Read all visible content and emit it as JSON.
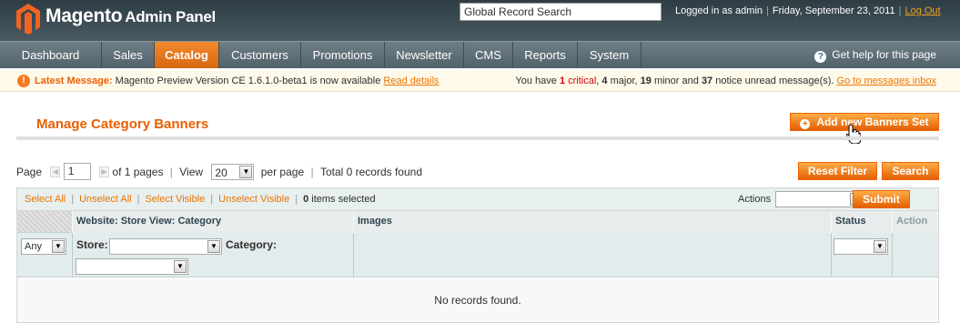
{
  "header": {
    "logo_text": "Magento",
    "logo_sub": "Admin Panel",
    "search_value": "Global Record Search",
    "logged_in": "Logged in as admin",
    "date": "Friday, September 23, 2011",
    "logout": "Log Out"
  },
  "nav": {
    "items": [
      "Dashboard",
      "Sales",
      "Catalog",
      "Customers",
      "Promotions",
      "Newsletter",
      "CMS",
      "Reports",
      "System"
    ],
    "active": "Catalog",
    "help": "Get help for this page"
  },
  "message": {
    "label": "Latest Message:",
    "text": "Magento Preview Version CE 1.6.1.0-beta1 is now available",
    "link": "Read details",
    "right_prefix": "You have",
    "critical_count": "1",
    "critical_label": "critical",
    "major": "4",
    "major_label": "major,",
    "minor": "19",
    "minor_label": "minor and",
    "notice": "37",
    "notice_label": "notice unread message(s).",
    "inbox_link": "Go to messages inbox"
  },
  "page": {
    "title": "Manage Category Banners",
    "add_button": "Add new Banners Set"
  },
  "pager": {
    "page_label": "Page",
    "page_value": "1",
    "of_pages": "of 1 pages",
    "view_label": "View",
    "limit": "20",
    "per_page": "per page",
    "total": "Total 0 records found",
    "reset": "Reset Filter",
    "search": "Search"
  },
  "massaction": {
    "select_all": "Select All",
    "unselect_all": "Unselect All",
    "select_visible": "Select Visible",
    "unselect_visible": "Unselect Visible",
    "count": "0",
    "items_selected": "items selected",
    "actions_label": "Actions",
    "submit": "Submit"
  },
  "grid": {
    "columns": [
      "Website: Store View: Category",
      "Images",
      "Status",
      "Action"
    ],
    "filter_any": "Any",
    "store_label": "Store:",
    "category_label": "Category:",
    "empty": "No records found."
  },
  "colors": {
    "accent": "#eb5e00",
    "header_bg": "#2e3d44",
    "nav_active": "#e8700f"
  }
}
